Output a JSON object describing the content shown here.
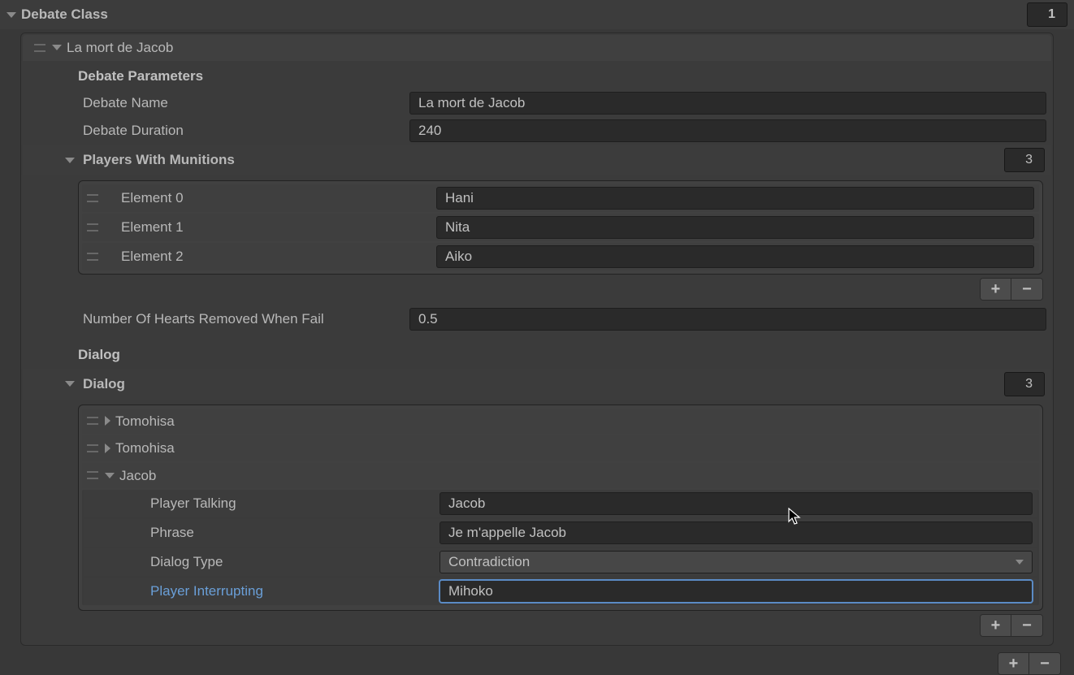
{
  "root": {
    "title": "Debate Class",
    "count": "1"
  },
  "element0": {
    "label": "La mort de Jacob"
  },
  "debate": {
    "heading": "Debate Parameters",
    "name_label": "Debate Name",
    "name_value": "La mort de Jacob",
    "duration_label": "Debate Duration",
    "duration_value": "240",
    "hearts_label": "Number Of Hearts Removed When Fail",
    "hearts_value": "0.5"
  },
  "players": {
    "label": "Players With Munitions",
    "count": "3",
    "items": [
      {
        "label": "Element 0",
        "value": "Hani"
      },
      {
        "label": "Element 1",
        "value": "Nita"
      },
      {
        "label": "Element 2",
        "value": "Aiko"
      }
    ]
  },
  "dialog": {
    "heading": "Dialog",
    "list_label": "Dialog",
    "count": "3",
    "rows": [
      {
        "label": "Tomohisa"
      },
      {
        "label": "Tomohisa"
      },
      {
        "label": "Jacob"
      }
    ],
    "entry": {
      "talking_label": "Player Talking",
      "talking_value": "Jacob",
      "phrase_label": "Phrase",
      "phrase_value": "Je m'appelle Jacob",
      "type_label": "Dialog Type",
      "type_value": "Contradiction",
      "interrupt_label": "Player Interrupting",
      "interrupt_value": "Mihoko"
    }
  },
  "icons": {
    "plus": "+",
    "minus": "−"
  }
}
